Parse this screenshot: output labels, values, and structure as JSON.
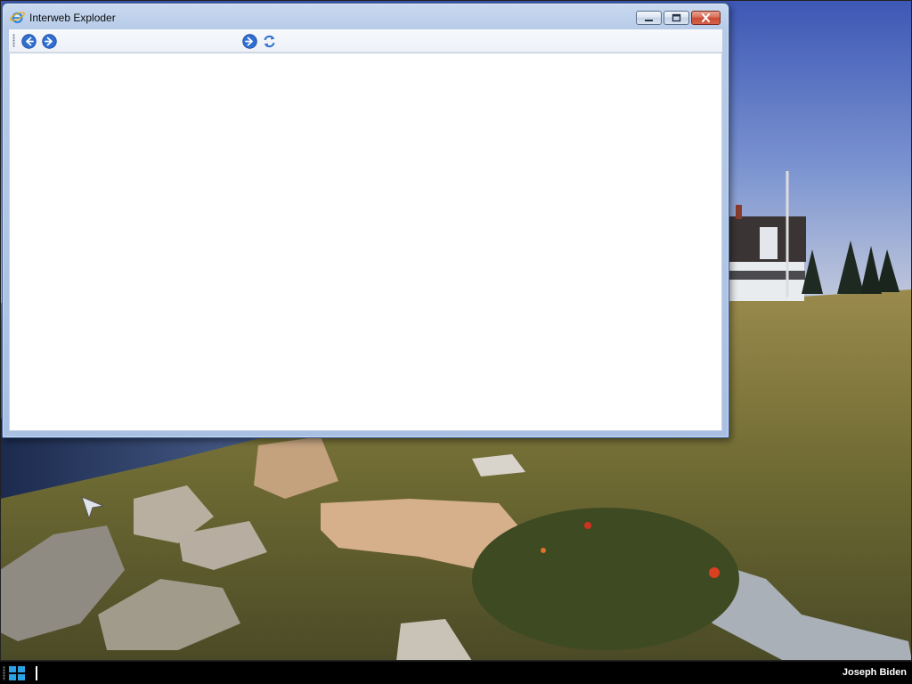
{
  "window": {
    "title": "Interweb Exploder",
    "controls": [
      "minimize",
      "maximize",
      "close"
    ]
  },
  "toolbar": {
    "buttons": [
      {
        "name": "back-icon"
      },
      {
        "name": "forward-icon"
      },
      {
        "name": "go-icon"
      },
      {
        "name": "refresh-icon"
      }
    ]
  },
  "taskbar": {
    "user_name": "Joseph Biden",
    "start_icon": "windows-logo-icon"
  },
  "colors": {
    "accent": "#2f6fd1",
    "window_frame": "#a9c0e2",
    "close_red": "#c94a33",
    "taskbar": "#000000"
  }
}
